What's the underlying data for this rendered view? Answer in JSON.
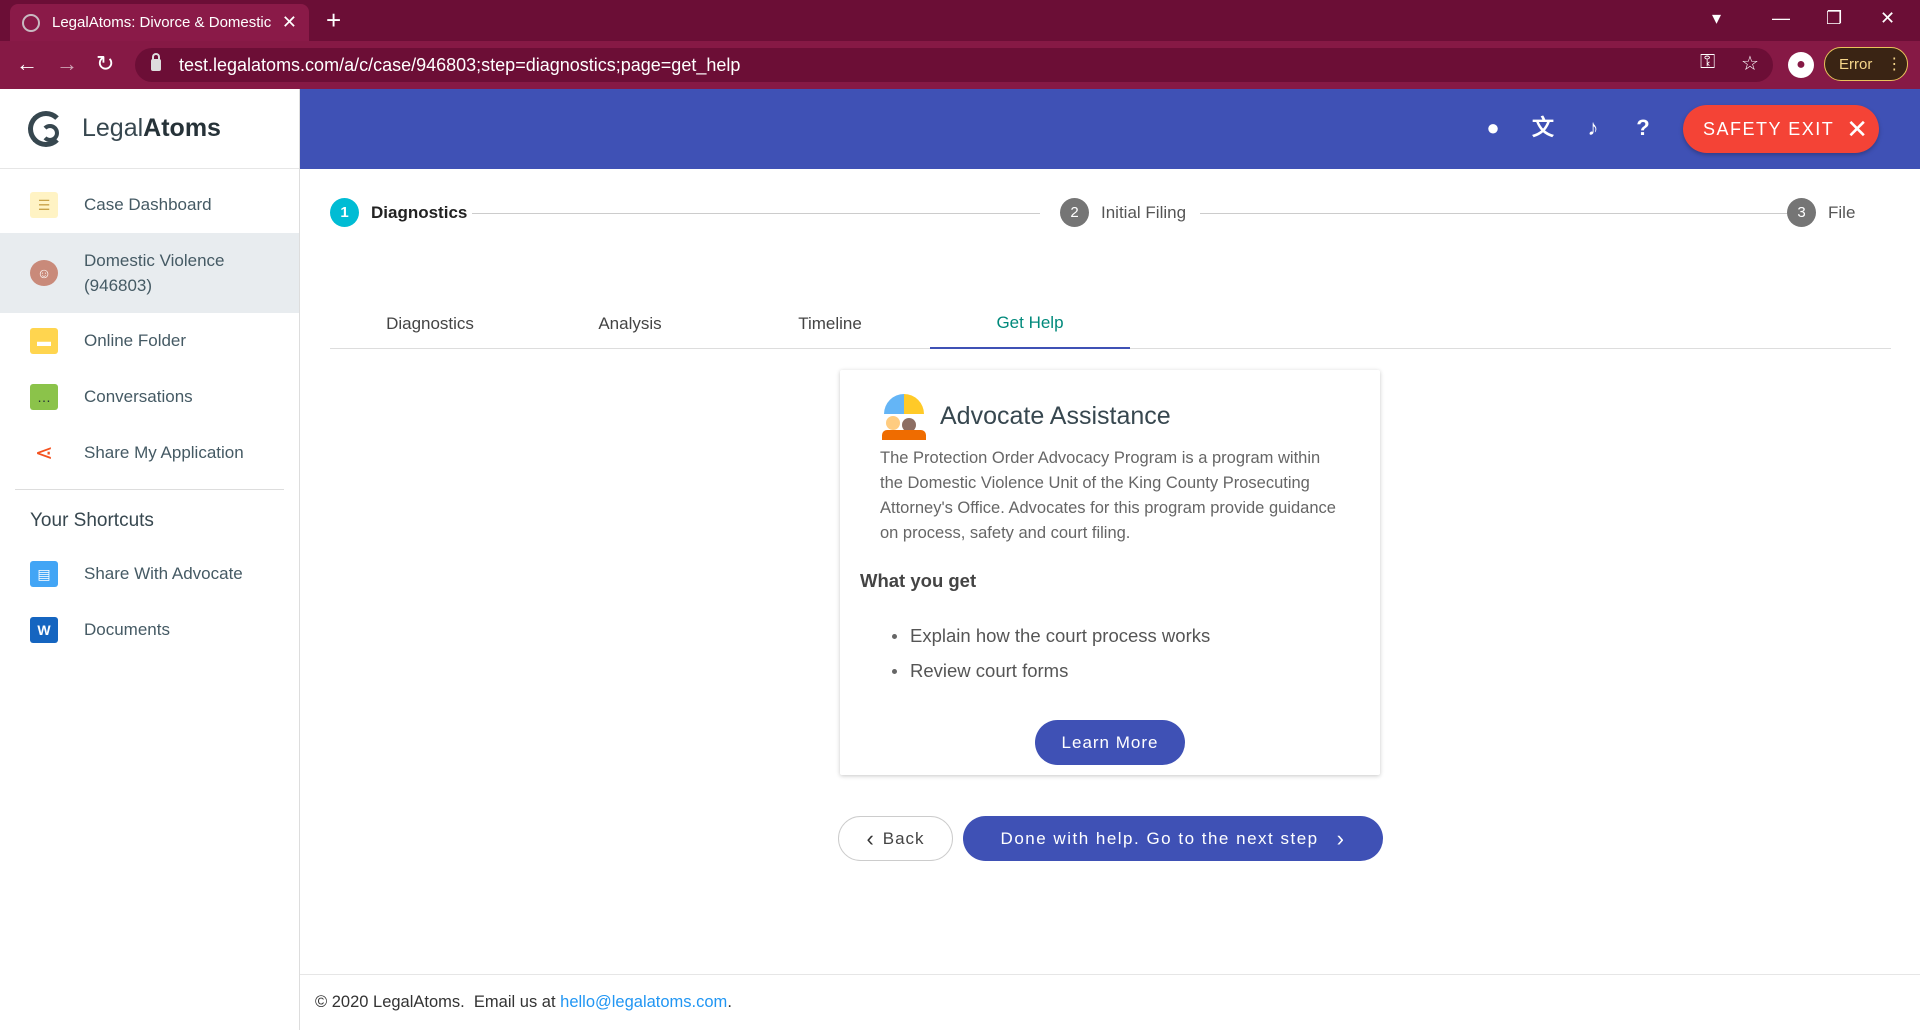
{
  "browser": {
    "tab_title": "LegalAtoms: Divorce & Domestic",
    "url": "test.legalatoms.com/a/c/case/946803;step=diagnostics;page=get_help",
    "error_label": "Error"
  },
  "brand": {
    "name_light": "Legal",
    "name_bold": "Atoms"
  },
  "sidebar": {
    "items": [
      {
        "label": "Case Dashboard",
        "icon": "list-icon"
      },
      {
        "label_line1": "Domestic Violence",
        "label_line2": "(946803)",
        "icon": "person-icon"
      },
      {
        "label": "Online Folder",
        "icon": "folder-icon"
      },
      {
        "label": "Conversations",
        "icon": "chat-icon"
      },
      {
        "label": "Share My Application",
        "icon": "share-icon"
      }
    ],
    "shortcuts_title": "Your Shortcuts",
    "shortcuts": [
      {
        "label": "Share With Advocate",
        "icon": "document-share-icon"
      },
      {
        "label": "Documents",
        "icon": "word-icon"
      }
    ]
  },
  "header": {
    "safety_exit": "SAFETY EXIT"
  },
  "stepper": [
    {
      "num": "1",
      "label": "Diagnostics"
    },
    {
      "num": "2",
      "label": "Initial Filing"
    },
    {
      "num": "3",
      "label": "File"
    }
  ],
  "tabs": [
    "Diagnostics",
    "Analysis",
    "Timeline",
    "Get Help"
  ],
  "card": {
    "title": "Advocate Assistance",
    "description": "The Protection Order Advocacy Program is a program within the Domestic Violence Unit of the King County Prosecuting Attorney's Office. Advocates for this program provide guidance on process, safety and court filing.",
    "subtitle": "What you get",
    "bullets": [
      "Explain how the court process works",
      "Review court forms"
    ],
    "button": "Learn More"
  },
  "actions": {
    "back": "Back",
    "next": "Done with help. Go to the next step"
  },
  "footer": {
    "copyright": "© 2020 LegalAtoms.",
    "email_prefix": "Email us at",
    "email": "hello@legalatoms.com",
    "email_suffix": "."
  },
  "colors": {
    "browser_frame": "#6b0e36",
    "header": "#3f51b5",
    "safety_exit": "#f44336",
    "active_step": "#00bcd4",
    "active_tab_text": "#00897b"
  }
}
